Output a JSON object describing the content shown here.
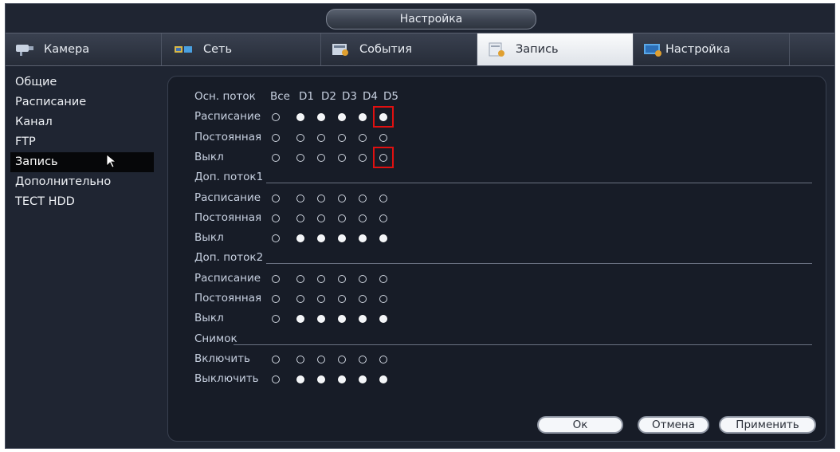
{
  "window": {
    "title": "Настройка"
  },
  "tabs": [
    {
      "label": "Камера",
      "icon": "camera-icon",
      "active": false
    },
    {
      "label": "Сеть",
      "icon": "network-icon",
      "active": false
    },
    {
      "label": "События",
      "icon": "events-icon",
      "active": false
    },
    {
      "label": "Запись",
      "icon": "record-icon",
      "active": true
    },
    {
      "label": "Настройка",
      "icon": "settings-icon",
      "active": false
    }
  ],
  "sidebar": {
    "items": [
      {
        "label": "Общие",
        "active": false
      },
      {
        "label": "Расписание",
        "active": false
      },
      {
        "label": "Канал",
        "active": false
      },
      {
        "label": "FTP",
        "active": false
      },
      {
        "label": "Запись",
        "active": true
      },
      {
        "label": "Дополнительно",
        "active": false
      },
      {
        "label": "ТЕСТ HDD",
        "active": false
      }
    ]
  },
  "grid": {
    "header_label": "Осн. поток",
    "columns": [
      "Все",
      "D1",
      "D2",
      "D3",
      "D4",
      "D5"
    ],
    "sections": [
      {
        "title": "",
        "rows": [
          {
            "label": "Расписание",
            "values": [
              false,
              true,
              true,
              true,
              true,
              true
            ]
          },
          {
            "label": "Постоянная",
            "values": [
              false,
              false,
              false,
              false,
              false,
              false
            ]
          },
          {
            "label": "Выкл",
            "values": [
              false,
              false,
              false,
              false,
              false,
              false
            ]
          }
        ]
      },
      {
        "title": "Доп. поток1",
        "rows": [
          {
            "label": "Расписание",
            "values": [
              false,
              false,
              false,
              false,
              false,
              false
            ]
          },
          {
            "label": "Постоянная",
            "values": [
              false,
              false,
              false,
              false,
              false,
              false
            ]
          },
          {
            "label": "Выкл",
            "values": [
              false,
              true,
              true,
              true,
              true,
              true
            ]
          }
        ]
      },
      {
        "title": "Доп. поток2",
        "rows": [
          {
            "label": "Расписание",
            "values": [
              false,
              false,
              false,
              false,
              false,
              false
            ]
          },
          {
            "label": "Постоянная",
            "values": [
              false,
              false,
              false,
              false,
              false,
              false
            ]
          },
          {
            "label": "Выкл",
            "values": [
              false,
              true,
              true,
              true,
              true,
              true
            ]
          }
        ]
      },
      {
        "title": "Снимок",
        "rows": [
          {
            "label": "Включить",
            "values": [
              false,
              false,
              false,
              false,
              false,
              false
            ]
          },
          {
            "label": "Выключить",
            "values": [
              false,
              true,
              true,
              true,
              true,
              true
            ]
          }
        ]
      }
    ]
  },
  "highlight_color": "#e01010",
  "buttons": {
    "ok": "Ок",
    "cancel": "Отмена",
    "apply": "Применить"
  }
}
